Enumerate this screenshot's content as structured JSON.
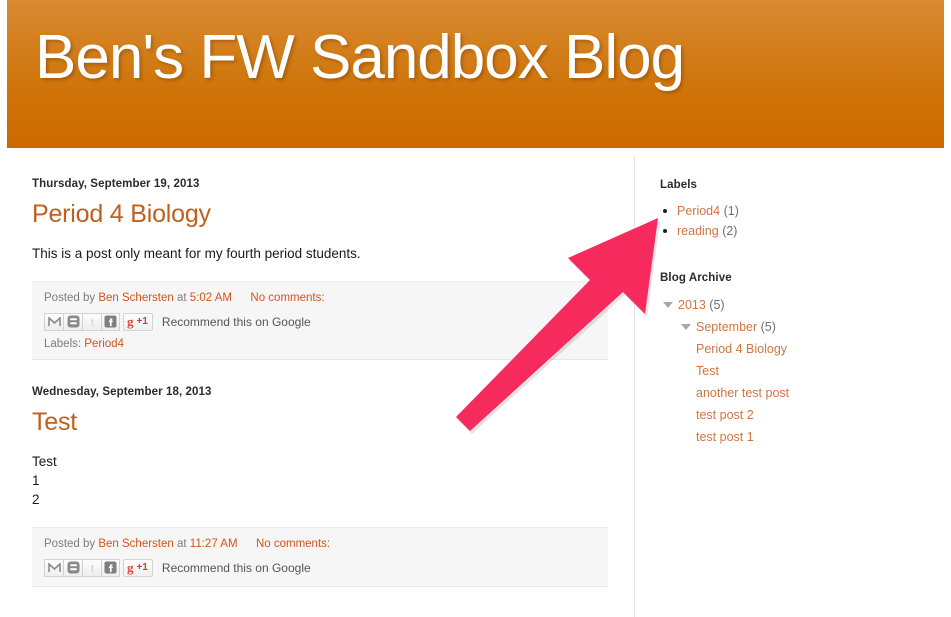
{
  "header": {
    "blog_title": "Ben's FW Sandbox Blog",
    "gradient_top": "#d98a33",
    "gradient_bottom": "#cc6a00"
  },
  "theme": {
    "link_color": "#d0551b",
    "title_color": "#bf601c",
    "sidebar_link_color": "#cc7744",
    "annotation_color": "#f72a5e"
  },
  "posts": [
    {
      "date": "Thursday, September 19, 2013",
      "title": "Period 4 Biology",
      "body_lines": [
        "This is a post only meant for my fourth period students."
      ],
      "footer": {
        "posted_by_label": "Posted by",
        "author": "Ben Schersten",
        "at_label": "at",
        "time": "5:02 AM",
        "comments": "No comments:",
        "share_icons": [
          "gmail-icon",
          "blogger-icon",
          "twitter-icon",
          "facebook-icon"
        ],
        "plusone_glyph": "g",
        "plusone_count": "+1",
        "recommend_text": "Recommend this on Google",
        "labels_label": "Labels:",
        "labels": [
          "Period4"
        ]
      }
    },
    {
      "date": "Wednesday, September 18, 2013",
      "title": "Test",
      "body_lines": [
        "Test",
        "1",
        "2"
      ],
      "footer": {
        "posted_by_label": "Posted by",
        "author": "Ben Schersten",
        "at_label": "at",
        "time": "11:27 AM",
        "comments": "No comments:",
        "share_icons": [
          "gmail-icon",
          "blogger-icon",
          "twitter-icon",
          "facebook-icon"
        ],
        "plusone_glyph": "g",
        "plusone_count": "+1",
        "recommend_text": "Recommend this on Google",
        "labels_label": "",
        "labels": []
      }
    }
  ],
  "sidebar": {
    "labels_widget": {
      "title": "Labels",
      "items": [
        {
          "name": "Period4",
          "count": "(1)"
        },
        {
          "name": "reading",
          "count": "(2)"
        }
      ]
    },
    "archive_widget": {
      "title": "Blog Archive",
      "year": {
        "label": "2013",
        "count": "(5)",
        "expanded": true
      },
      "month": {
        "label": "September",
        "count": "(5)",
        "expanded": true
      },
      "posts": [
        "Period 4 Biology",
        "Test",
        "another test post",
        "test post 2",
        "test post 1"
      ]
    }
  },
  "annotation": {
    "type": "arrow",
    "points_from": "post-footer-area",
    "points_to": "labels-widget"
  }
}
